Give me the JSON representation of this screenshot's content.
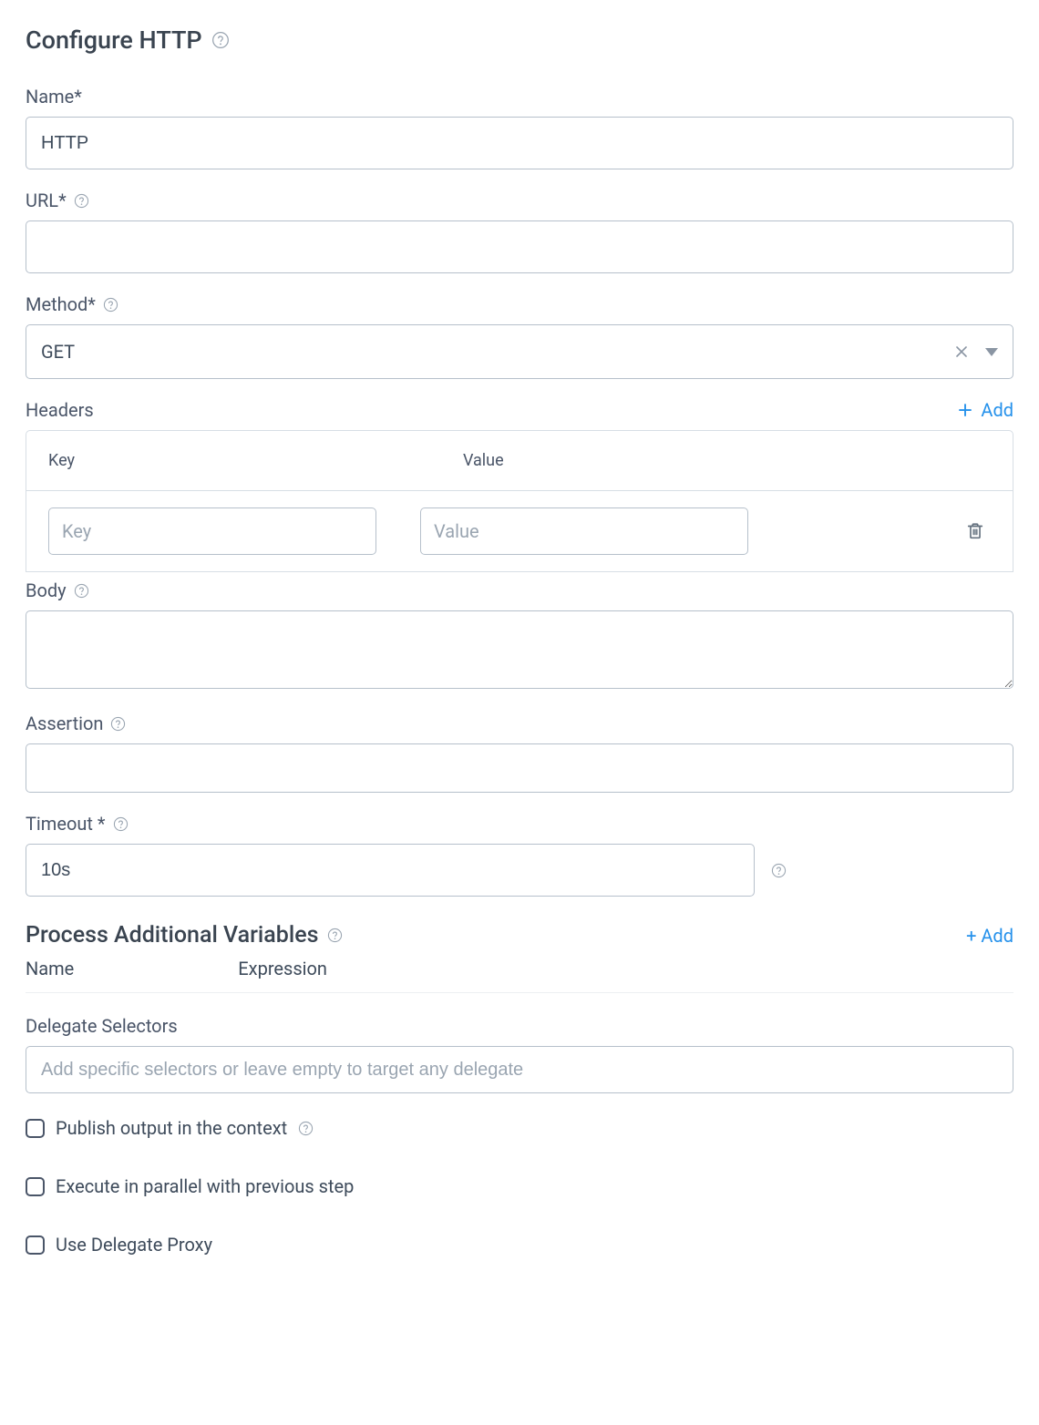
{
  "page_title": "Configure HTTP",
  "fields": {
    "name": {
      "label": "Name*",
      "value": "HTTP"
    },
    "url": {
      "label": "URL*",
      "value": ""
    },
    "method": {
      "label": "Method*",
      "value": "GET"
    },
    "body": {
      "label": "Body",
      "value": ""
    },
    "assertion": {
      "label": "Assertion",
      "value": ""
    },
    "timeout": {
      "label": "Timeout *",
      "value": "10s"
    },
    "delegate_selectors": {
      "label": "Delegate Selectors",
      "placeholder": "Add specific selectors or leave empty to target any delegate",
      "value": ""
    }
  },
  "headers": {
    "label": "Headers",
    "add_label": "Add",
    "col_key": "Key",
    "col_value": "Value",
    "rows": [
      {
        "key": "",
        "value": "",
        "key_placeholder": "Key",
        "value_placeholder": "Value"
      }
    ]
  },
  "process_vars": {
    "title": "Process Additional Variables",
    "add_label": "+ Add",
    "col_name": "Name",
    "col_expression": "Expression"
  },
  "checkboxes": {
    "publish_output": {
      "label": "Publish output in the context",
      "checked": false
    },
    "execute_parallel": {
      "label": "Execute in parallel with previous step",
      "checked": false
    },
    "use_delegate_proxy": {
      "label": "Use Delegate Proxy",
      "checked": false
    }
  }
}
